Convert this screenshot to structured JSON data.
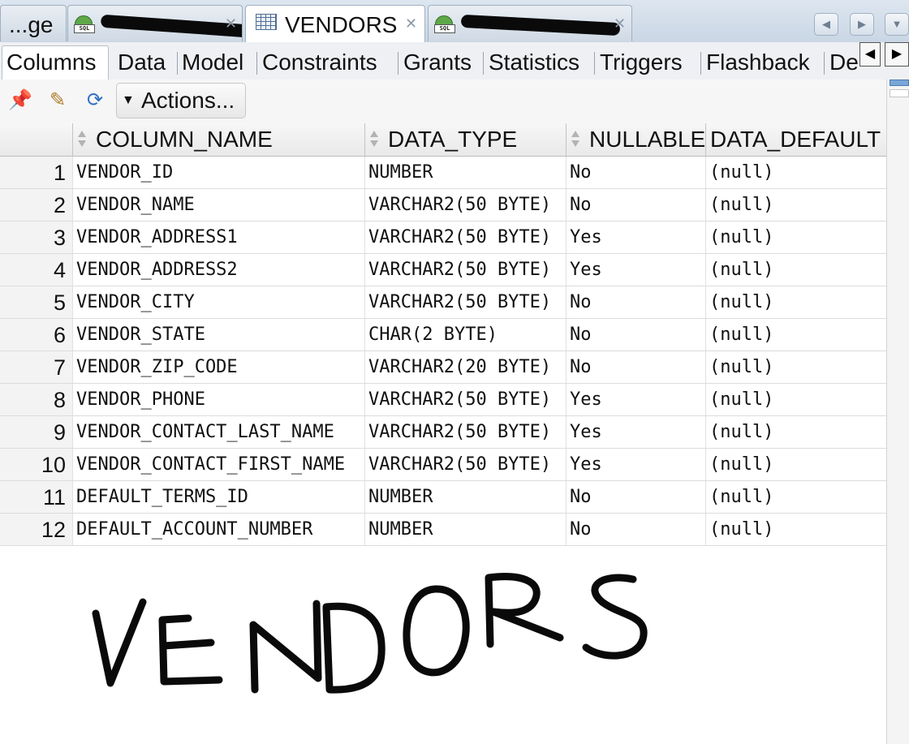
{
  "doc_tabs": [
    {
      "label": "...ge",
      "redacted": false
    },
    {
      "label": "",
      "redacted": true
    },
    {
      "label": "VENDORS",
      "active": true
    },
    {
      "label": "",
      "redacted": true
    }
  ],
  "sub_tabs": [
    "Columns",
    "Data",
    "Model",
    "Constraints",
    "Grants",
    "Statistics",
    "Triggers",
    "Flashback",
    "De"
  ],
  "toolbar": {
    "icons": [
      "pin-icon",
      "edit-icon",
      "refresh-icon"
    ],
    "actions_label": "Actions..."
  },
  "table": {
    "headers": [
      "COLUMN_NAME",
      "DATA_TYPE",
      "NULLABLE",
      "DATA_DEFAULT"
    ],
    "rows": [
      {
        "num": "1",
        "name": "VENDOR_ID",
        "type": "NUMBER",
        "nullable": "No",
        "default": "(null)"
      },
      {
        "num": "2",
        "name": "VENDOR_NAME",
        "type": "VARCHAR2(50 BYTE)",
        "nullable": "No",
        "default": "(null)"
      },
      {
        "num": "3",
        "name": "VENDOR_ADDRESS1",
        "type": "VARCHAR2(50 BYTE)",
        "nullable": "Yes",
        "default": "(null)"
      },
      {
        "num": "4",
        "name": "VENDOR_ADDRESS2",
        "type": "VARCHAR2(50 BYTE)",
        "nullable": "Yes",
        "default": "(null)"
      },
      {
        "num": "5",
        "name": "VENDOR_CITY",
        "type": "VARCHAR2(50 BYTE)",
        "nullable": "No",
        "default": "(null)"
      },
      {
        "num": "6",
        "name": "VENDOR_STATE",
        "type": "CHAR(2 BYTE)",
        "nullable": "No",
        "default": "(null)"
      },
      {
        "num": "7",
        "name": "VENDOR_ZIP_CODE",
        "type": "VARCHAR2(20 BYTE)",
        "nullable": "No",
        "default": "(null)"
      },
      {
        "num": "8",
        "name": "VENDOR_PHONE",
        "type": "VARCHAR2(50 BYTE)",
        "nullable": "Yes",
        "default": "(null)"
      },
      {
        "num": "9",
        "name": "VENDOR_CONTACT_LAST_NAME",
        "type": "VARCHAR2(50 BYTE)",
        "nullable": "Yes",
        "default": "(null)"
      },
      {
        "num": "10",
        "name": "VENDOR_CONTACT_FIRST_NAME",
        "type": "VARCHAR2(50 BYTE)",
        "nullable": "Yes",
        "default": "(null)"
      },
      {
        "num": "11",
        "name": "DEFAULT_TERMS_ID",
        "type": "NUMBER",
        "nullable": "No",
        "default": "(null)"
      },
      {
        "num": "12",
        "name": "DEFAULT_ACCOUNT_NUMBER",
        "type": "NUMBER",
        "nullable": "No",
        "default": "(null)"
      }
    ]
  },
  "handwritten_note": "VENDORS",
  "colors": {
    "tab_bar": "#c9d6e4",
    "accent": "#4f6d92"
  }
}
